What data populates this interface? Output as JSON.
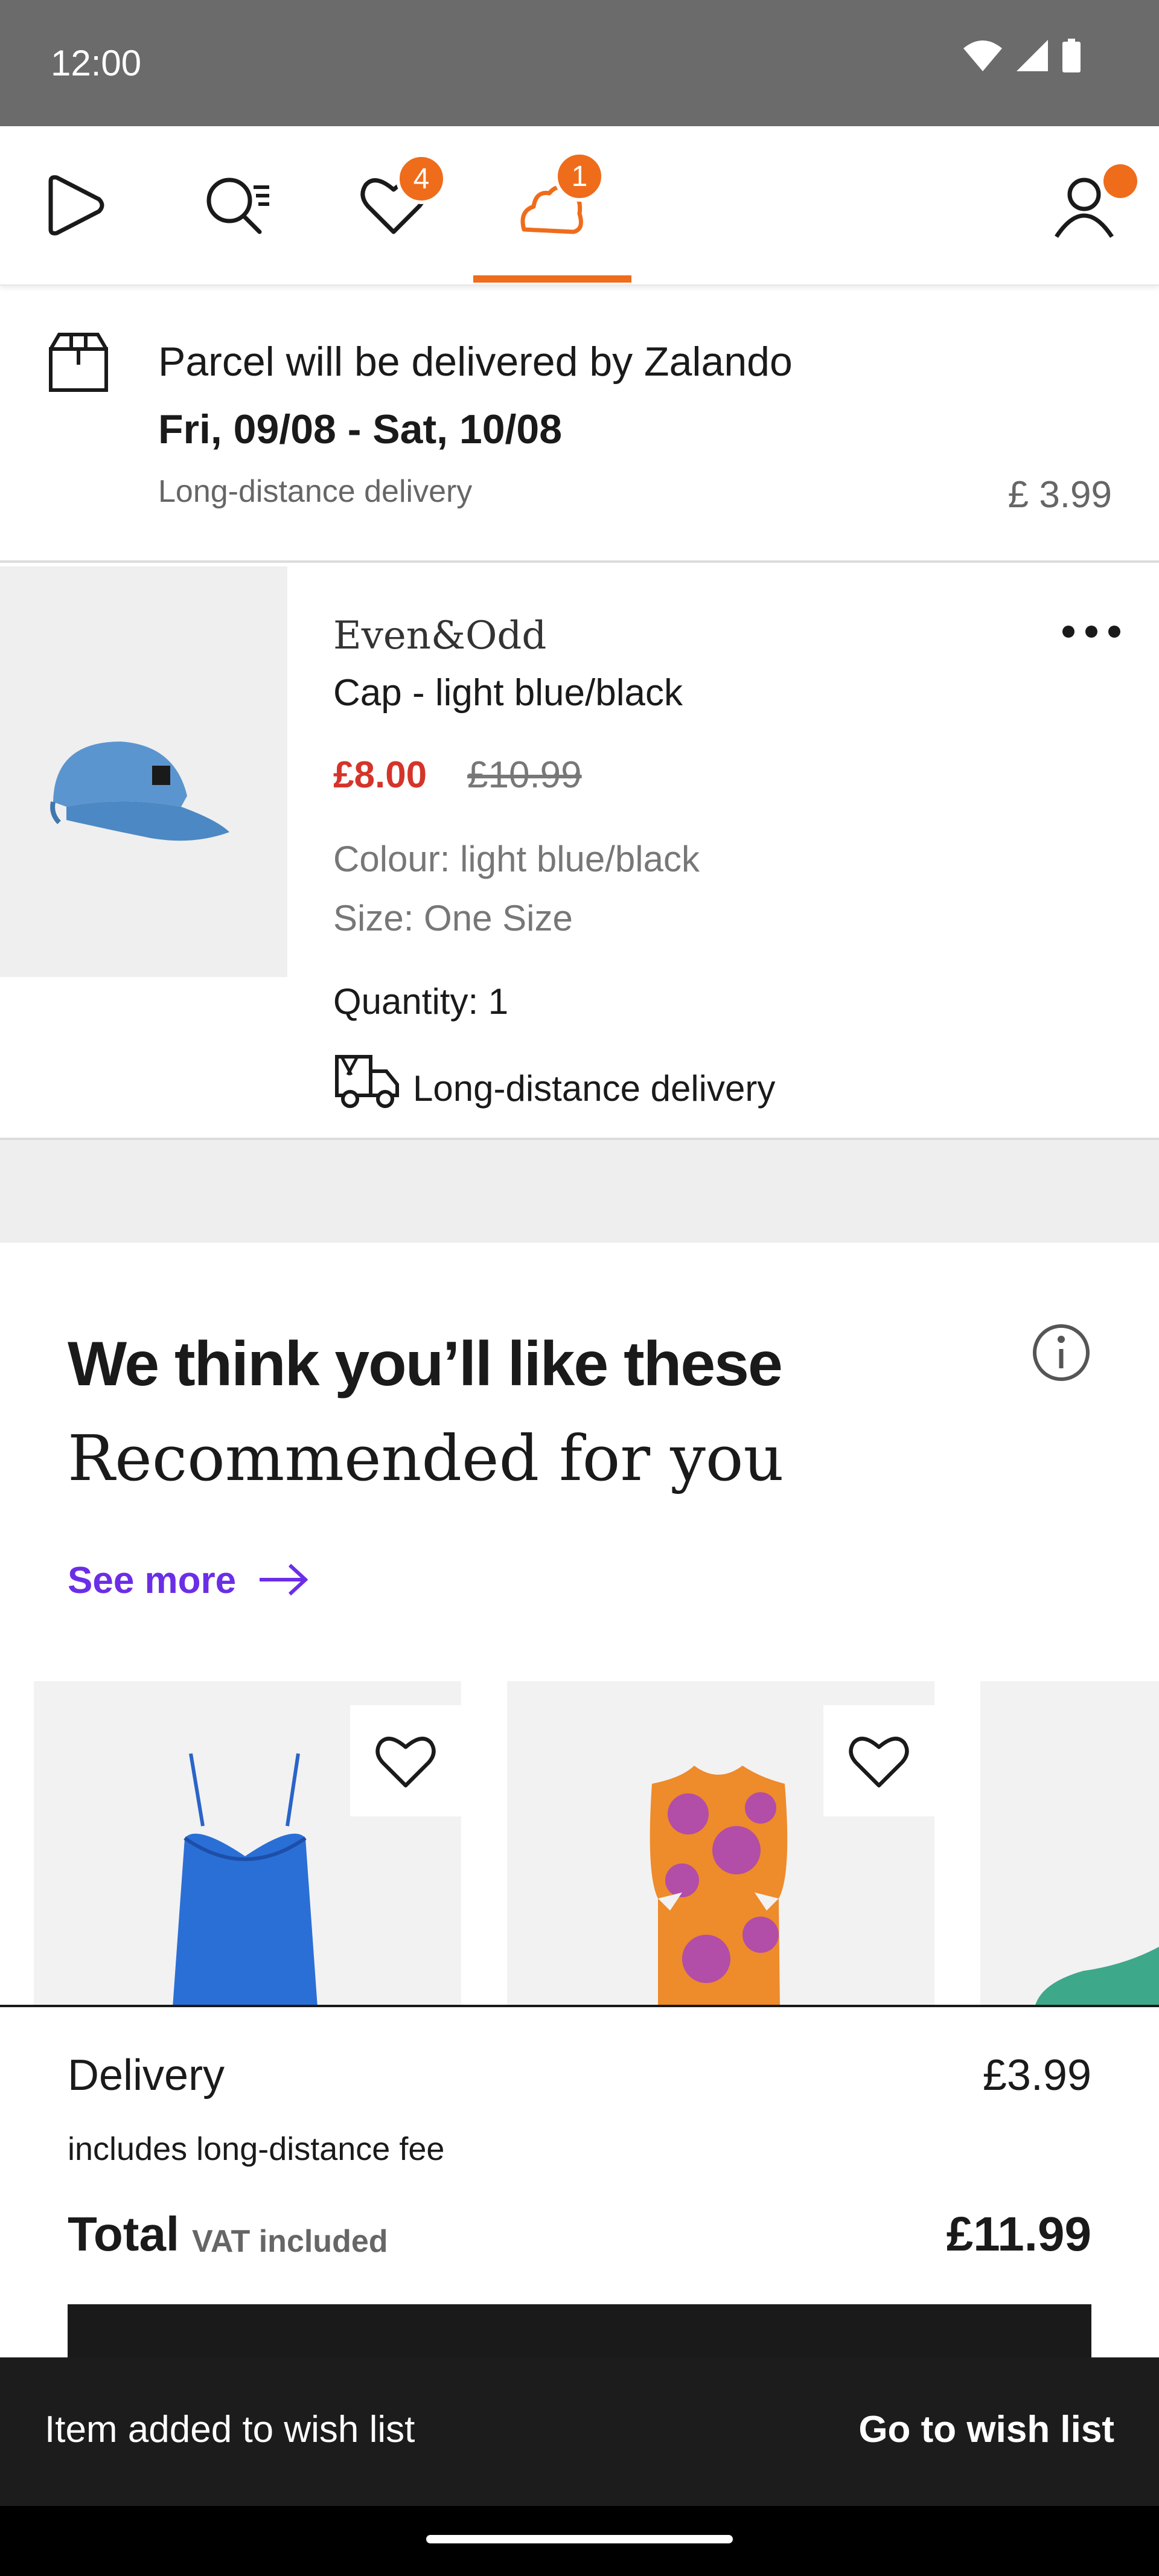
{
  "status_bar": {
    "time": "12:00"
  },
  "nav": {
    "wishlist_badge": "4",
    "bag_badge": "1"
  },
  "delivery": {
    "title": "Parcel will be delivered by Zalando",
    "dates": "Fri, 09/08 - Sat, 10/08",
    "type": "Long-distance delivery",
    "price": "£ 3.99"
  },
  "item": {
    "brand": "Even&Odd",
    "name": "Cap - light blue/black",
    "sale_price": "£8.00",
    "original_price": "£10.99",
    "colour": "Colour: light blue/black",
    "size": "Size: One Size",
    "quantity": "Quantity: 1",
    "delivery": "Long-distance delivery"
  },
  "recommendations": {
    "title": "We think you’ll like these",
    "subtitle": "Recommended for you",
    "see_more": "See more"
  },
  "summary": {
    "delivery_label": "Delivery",
    "delivery_price": "£3.99",
    "delivery_note": "includes long-distance fee",
    "total_label": "Total",
    "vat_note": "VAT included",
    "total_price": "£11.99"
  },
  "snackbar": {
    "message": "Item added to wish list",
    "action": "Go to wish list"
  },
  "colors": {
    "accent": "#ef6c1b",
    "sale": "#d4342a",
    "link": "#6b2ee6"
  }
}
